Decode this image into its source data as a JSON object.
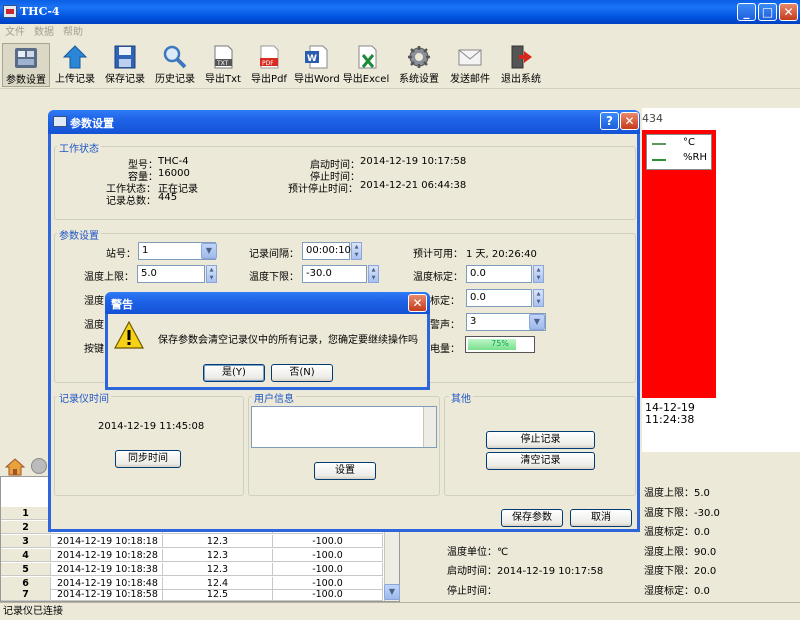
{
  "app": {
    "title": "THC-4"
  },
  "menu": [
    "文件",
    "数据",
    "帮助"
  ],
  "toolbar": [
    {
      "label": "参数设置",
      "icon": "settings-icon"
    },
    {
      "label": "上传记录",
      "icon": "upload-icon"
    },
    {
      "label": "保存记录",
      "icon": "save-icon"
    },
    {
      "label": "历史记录",
      "icon": "search-icon"
    },
    {
      "label": "导出Txt",
      "icon": "txt-file-icon"
    },
    {
      "label": "导出Pdf",
      "icon": "pdf-file-icon"
    },
    {
      "label": "导出Word",
      "icon": "word-file-icon"
    },
    {
      "label": "导出Excel",
      "icon": "excel-file-icon"
    },
    {
      "label": "系统设置",
      "icon": "gear-icon"
    },
    {
      "label": "发送邮件",
      "icon": "mail-icon"
    },
    {
      "label": "退出系统",
      "icon": "exit-icon"
    }
  ],
  "chart": {
    "number_partial": "434",
    "legend": [
      {
        "name": "°C",
        "color": "#5a9a5a"
      },
      {
        "name": "%RH",
        "color": "#2f8f2f"
      }
    ],
    "time_label_1": "14-12-19",
    "time_label_2": "11:24:38",
    "fill_color": "#FF0000"
  },
  "table": {
    "rows": [
      {
        "idx": "1",
        "time": "",
        "temp": "",
        "hum": ""
      },
      {
        "idx": "2",
        "time": "",
        "temp": "",
        "hum": ""
      },
      {
        "idx": "3",
        "time": "2014-12-19 10:18:18",
        "temp": "12.3",
        "hum": "-100.0"
      },
      {
        "idx": "4",
        "time": "2014-12-19 10:18:28",
        "temp": "12.3",
        "hum": "-100.0"
      },
      {
        "idx": "5",
        "time": "2014-12-19 10:18:38",
        "temp": "12.3",
        "hum": "-100.0"
      },
      {
        "idx": "6",
        "time": "2014-12-19 10:18:48",
        "temp": "12.4",
        "hum": "-100.0"
      },
      {
        "idx": "7",
        "time": "2014-12-19 10:18:58",
        "temp": "12.5",
        "hum": "-100.0"
      }
    ]
  },
  "right_info": {
    "temp_high": "温度上限：5.0",
    "temp_low": "温度下限：-30.0",
    "temp_cal": "温度标定：0.0",
    "hum_high": "湿度上限：90.0",
    "hum_low": "湿度下限：20.0",
    "hum_cal": "湿度标定：0.0",
    "temp_unit": "温度单位：℃",
    "start_time": "启动时间：2014-12-19 10:17:58",
    "stop_time": "停止时间："
  },
  "status": "记录仪已连接",
  "param_dialog": {
    "title": "参数设置",
    "work_state": {
      "legend": "工作状态",
      "model_label": "型号：",
      "model": "THC-4",
      "capacity_label": "容量：",
      "capacity": "16000",
      "state_label": "工作状态：",
      "state": "正在记录",
      "total_label": "记录总数：",
      "total": "445",
      "start_label": "启动时间：",
      "start": "2014-12-19 10:17:58",
      "stop_label": "停止时间：",
      "stop": "",
      "expected_stop_label": "预计停止时间：",
      "expected_stop": "2014-12-21 06:44:38"
    },
    "params": {
      "legend": "参数设置",
      "station_label": "站号：",
      "station": "1",
      "interval_label": "记录间隔：",
      "interval": "00:00:10",
      "available_label": "预计可用：",
      "available": "1 天, 20:26:40",
      "temp_high_label": "温度上限：",
      "temp_high": "5.0",
      "temp_low_label": "温度下限：",
      "temp_low": "-30.0",
      "temp_cal_label": "温度标定：",
      "temp_cal": "0.0",
      "hum_cal_partial_label": "标定：",
      "hum_cal": "0.0",
      "alarm_partial_label": "警声：",
      "alarm": "3",
      "battery_partial_label": "电量：",
      "battery_pct": "75%",
      "battery_fraction": 0.75,
      "partial_left_1": "湿度",
      "partial_left_2": "温度",
      "partial_left_3": "按键"
    },
    "logger_time": {
      "legend": "记录仪时间",
      "time": "2014-12-19 11:45:08",
      "sync_btn": "同步时间"
    },
    "user_info": {
      "legend": "用户信息",
      "set_btn": "设置"
    },
    "other": {
      "legend": "其他",
      "stop_btn": "停止记录",
      "clear_btn": "清空记录"
    },
    "save_btn": "保存参数",
    "cancel_btn": "取消"
  },
  "warning": {
    "title": "警告",
    "message": "保存参数会清空记录仪中的所有记录，您确定要继续操作吗",
    "yes": "是(Y)",
    "no": "否(N)"
  }
}
